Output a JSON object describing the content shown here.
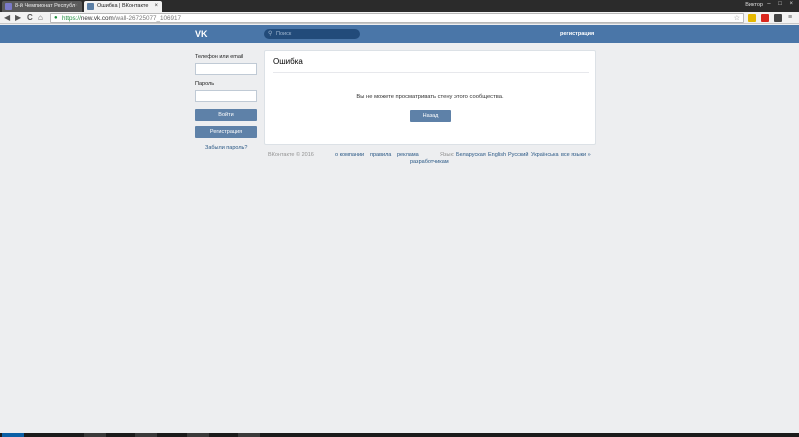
{
  "browser": {
    "tabs": [
      {
        "title": "8-й Чемпионат Республ"
      },
      {
        "title": "Ошибка | ВКонтакте"
      }
    ],
    "close_glyph": "×",
    "user_name": "Виктор",
    "window_controls": "– □ ×",
    "nav": {
      "back": "◀",
      "forward": "▶",
      "reload": "C",
      "home": "⌂"
    },
    "url": {
      "scheme": "https://",
      "host": "new.vk.com",
      "path": "/wall-26725077_106917"
    },
    "lock_icon": "🔒",
    "star_icon": "☆"
  },
  "header": {
    "logo": "VK",
    "search_placeholder": "Поиск",
    "register_link": "регистрация"
  },
  "login": {
    "phone_label": "Телефон или email",
    "password_label": "Пароль",
    "login_button": "Войти",
    "register_button": "Регистрация",
    "forgot_link": "Забыли пароль?"
  },
  "error": {
    "title": "Ошибка",
    "message": "Вы не можете просматривать стену этого сообщества.",
    "back_button": "Назад"
  },
  "footer": {
    "copyright": "ВКонтакте © 2016",
    "links": [
      "о компании",
      "правила",
      "реклама",
      "разработчикам"
    ],
    "language_label": "Язык:",
    "languages": [
      "Беларуская",
      "English",
      "Русский",
      "Українська",
      "все языки »"
    ]
  },
  "colors": {
    "header_bg": "#4a76a8",
    "button_bg": "#5e81a8",
    "page_bg": "#edeef0",
    "link": "#2a5885"
  }
}
